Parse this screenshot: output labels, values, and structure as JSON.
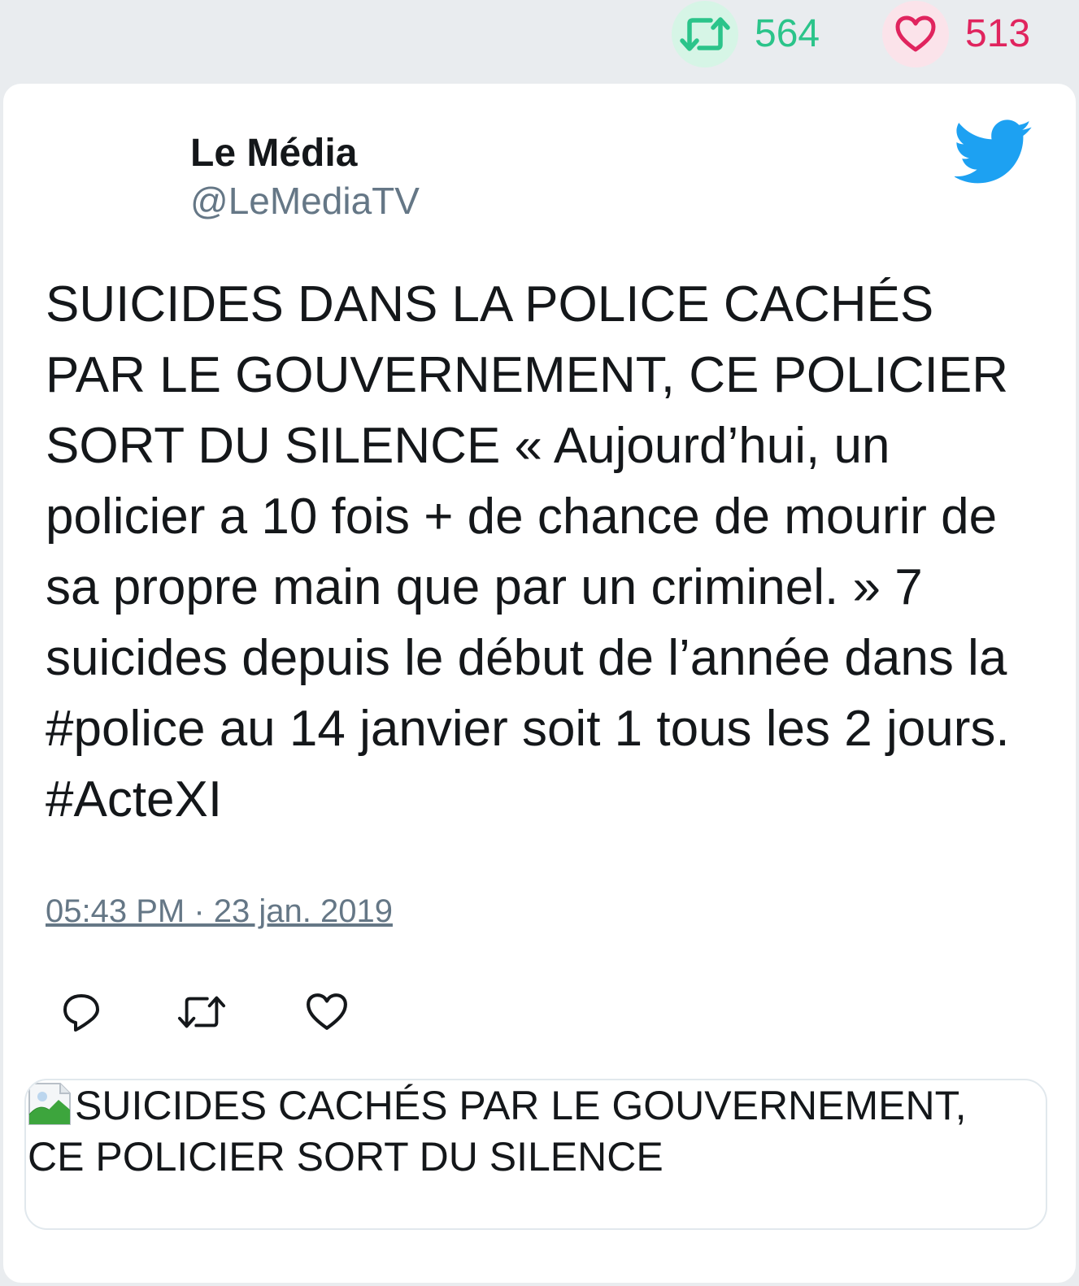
{
  "stats": {
    "retweets": "564",
    "likes": "513",
    "retweet_color": "#2bc48a",
    "like_color": "#e0245e"
  },
  "author": {
    "name": "Le Média",
    "handle": "@LeMediaTV"
  },
  "tweet": {
    "text": "SUICIDES DANS LA POLICE CACHÉS PAR LE GOUVERNEMENT, CE POLICIER SORT DU SILENCE « Aujourd’hui, un policier a 10 fois + de chance de mourir de sa propre main que par un criminel. » 7 suicides depuis le début de l’année dans la #police au 14 janvier soit 1 tous les 2 jours. #ActeXI",
    "timestamp": "05:43 PM · 23 jan. 2019"
  },
  "icons": {
    "retweet": "retweet-icon",
    "like": "heart-icon",
    "reply": "reply-icon",
    "brand": "twitter-bird-icon",
    "image": "broken-image-icon"
  },
  "link_card": {
    "title": "SUICIDES CACHÉS PAR LE GOUVERNEMENT, CE POLICIER SORT DU SILENCE"
  },
  "colors": {
    "brand": "#1da1f2",
    "text": "#14171a",
    "secondary": "#657786"
  }
}
